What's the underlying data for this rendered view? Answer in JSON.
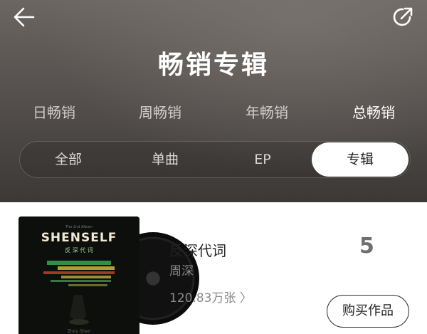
{
  "header": {
    "title": "畅销专辑",
    "period_tabs": [
      {
        "label": "日畅销",
        "active": false
      },
      {
        "label": "周畅销",
        "active": false
      },
      {
        "label": "年畅销",
        "active": false
      },
      {
        "label": "总畅销",
        "active": true
      }
    ],
    "type_tabs": [
      {
        "label": "全部",
        "active": false
      },
      {
        "label": "单曲",
        "active": false
      },
      {
        "label": "EP",
        "active": false
      },
      {
        "label": "专辑",
        "active": true
      }
    ],
    "back_icon": "arrow-left-icon",
    "share_icon": "share-icon"
  },
  "album": {
    "cover_title": "SHENSELF",
    "cover_subtitle": "反 深 代 词",
    "cover_top_text": "The 2nd Album",
    "cover_bottom_text": "Zhou Shen",
    "name": "反深代词",
    "artist": "周深",
    "sales": "120.83万张 〉",
    "rank": "5",
    "buy_label": "购买作品"
  },
  "colors": {
    "header_bg": "#55504d",
    "active_seg_bg": "#ffffff",
    "rank_color": "#6f6f6f"
  }
}
